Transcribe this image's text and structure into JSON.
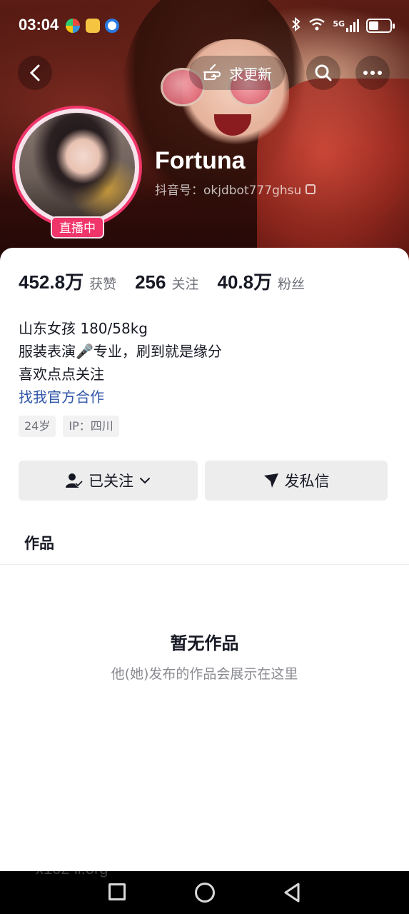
{
  "status_bar": {
    "time": "03:04",
    "network": "5G"
  },
  "top_nav": {
    "update_label": "求更新"
  },
  "profile": {
    "name": "Fortuna",
    "douyin_id": "抖音号：okjdbot777ghsu",
    "live_badge": "直播中"
  },
  "stats": [
    {
      "value": "452.8万",
      "label": "获赞"
    },
    {
      "value": "256",
      "label": "关注"
    },
    {
      "value": "40.8万",
      "label": "粉丝"
    }
  ],
  "bio": {
    "line1": "山东女孩 180/58kg",
    "line2": "服装表演🎤专业，刷到就是缘分",
    "line3": "喜欢点点关注",
    "link": "找我官方合作"
  },
  "tags": {
    "age": "24岁",
    "ip": "IP：四川"
  },
  "actions": {
    "follow_label": "已关注",
    "message_label": "发私信"
  },
  "tabs": {
    "works": "作品"
  },
  "empty_state": {
    "title": "暂无作品",
    "subtitle": "他(她)发布的作品会展示在这里"
  },
  "watermark": "x102 ll.org",
  "colors": {
    "accent": "#f0356a",
    "link": "#2d54a8",
    "text": "#161823"
  }
}
